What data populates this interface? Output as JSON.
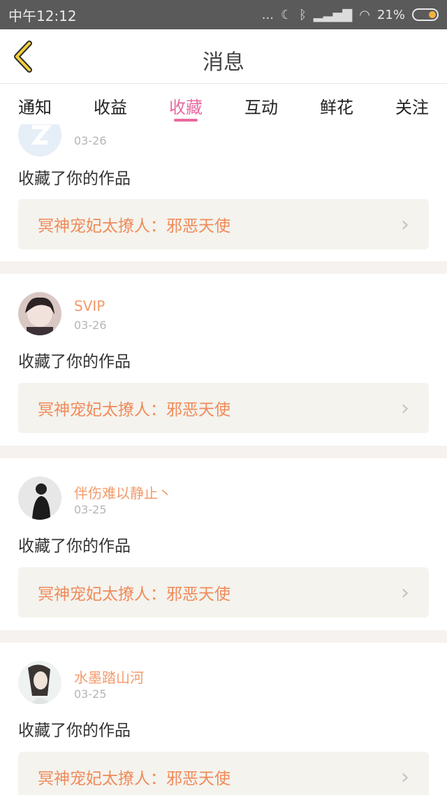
{
  "status": {
    "time": "中午12:12",
    "dots": "...",
    "battery": "21%"
  },
  "header": {
    "title": "消息"
  },
  "tabs": [
    "通知",
    "收益",
    "收藏",
    "互动",
    "鲜花",
    "关注"
  ],
  "feed": [
    {
      "user": "",
      "date": "03-26",
      "action": "收藏了你的作品",
      "work": "冥神宠妃太撩人：邪恶天使"
    },
    {
      "user": "SVIP",
      "date": "03-26",
      "action": "收藏了你的作品",
      "work": "冥神宠妃太撩人：邪恶天使"
    },
    {
      "user": "伴伤难以静止丶",
      "date": "03-25",
      "action": "收藏了你的作品",
      "work": "冥神宠妃太撩人：邪恶天使"
    },
    {
      "user": "水墨踏山河",
      "date": "03-25",
      "action": "收藏了你的作品",
      "work": "冥神宠妃太撩人：邪恶天使"
    }
  ],
  "colors": {
    "accent": "#e86aa0",
    "username": "#f39a6a",
    "work_title": "#f08a5a"
  }
}
